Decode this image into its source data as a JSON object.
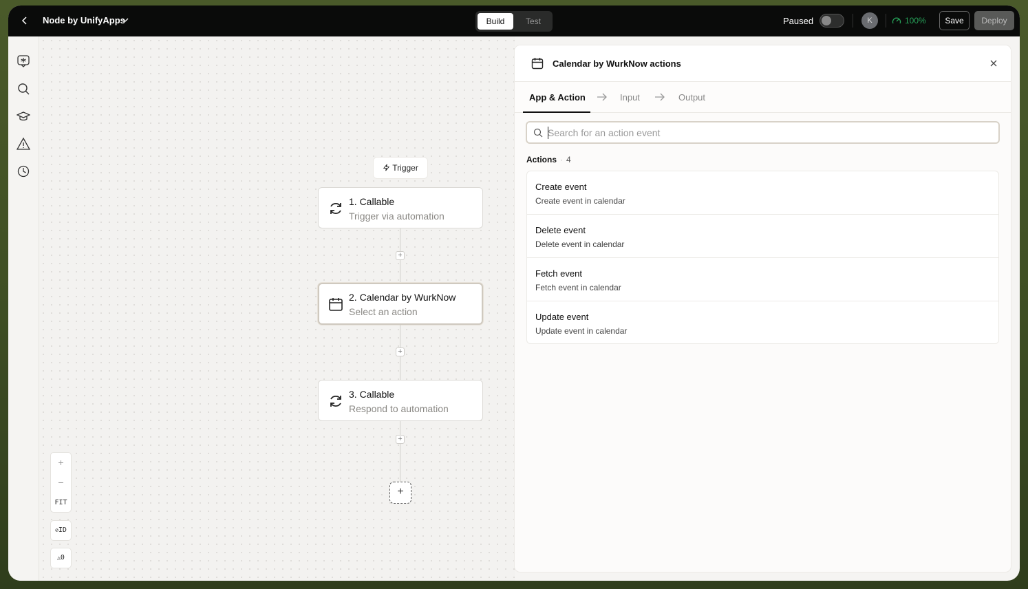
{
  "topbar": {
    "app_name": "Node by UnifyApps",
    "segments": {
      "build": "Build",
      "test": "Test"
    },
    "paused_label": "Paused",
    "avatar_initial": "K",
    "percent": "100%",
    "save_label": "Save",
    "deploy_label": "Deploy"
  },
  "canvas": {
    "trigger_label": "Trigger",
    "nodes": [
      {
        "title": "1. Callable",
        "subtitle": "Trigger via automation"
      },
      {
        "title": "2. Calendar by WurkNow",
        "subtitle": "Select an action"
      },
      {
        "title": "3. Callable",
        "subtitle": "Respond to automation"
      }
    ],
    "zoom": {
      "in": "+",
      "out": "−",
      "fit": "FIT"
    },
    "id_toggle": "ID",
    "warnings": "0"
  },
  "panel": {
    "title": "Calendar by WurkNow actions",
    "tabs": [
      "App & Action",
      "Input",
      "Output"
    ],
    "search_placeholder": "Search for an action event",
    "actions_label": "Actions",
    "actions_count": "4",
    "actions": [
      {
        "title": "Create event",
        "subtitle": "Create event in calendar"
      },
      {
        "title": "Delete event",
        "subtitle": "Delete event in calendar"
      },
      {
        "title": "Fetch event",
        "subtitle": "Fetch event in calendar"
      },
      {
        "title": "Update event",
        "subtitle": "Update event in calendar"
      }
    ]
  },
  "colors": {
    "accent_green": "#27a35a",
    "topbar_bg": "#0a0b0a"
  }
}
